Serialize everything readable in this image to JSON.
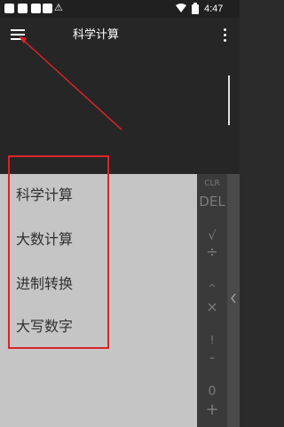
{
  "status_bar": {
    "time": "4:47",
    "warning_glyph": "⚠"
  },
  "app_bar": {
    "title": "科学计算",
    "menu_icon": "hamburger-menu-icon",
    "overflow_icon": "more-vert-icon"
  },
  "keypad": {
    "keys": [
      "CLR",
      "DEL",
      "√",
      "÷",
      "^",
      "×",
      "!",
      "-",
      "0",
      "+"
    ]
  },
  "drawer": {
    "items": [
      {
        "label": "科学计算"
      },
      {
        "label": "大数计算"
      },
      {
        "label": "进制转换"
      },
      {
        "label": "大写数字"
      }
    ]
  },
  "annotation_color": "#d9242a"
}
